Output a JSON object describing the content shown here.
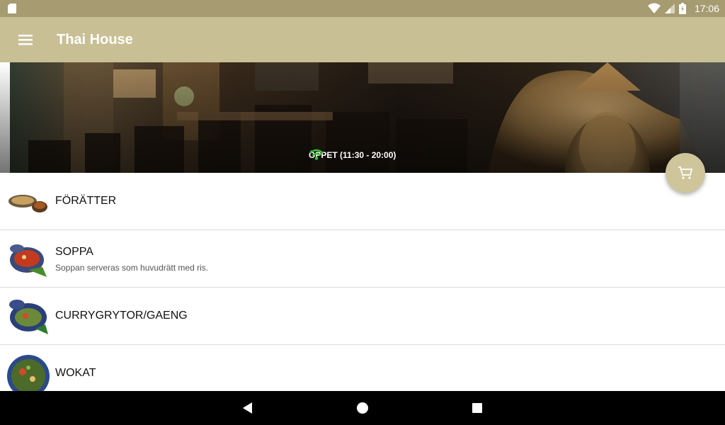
{
  "status_bar": {
    "time": "17:06",
    "icons": [
      "sd-card-icon",
      "wifi-icon",
      "signal-icon",
      "battery-icon"
    ]
  },
  "app_bar": {
    "title": "Thai House",
    "menu_icon": "hamburger-menu-icon",
    "background": "#c9bf95"
  },
  "hero": {
    "open_status": "ÖPPET (11:30 - 20:00)",
    "status_icon": "wifi-icon",
    "status_color": "#3dbf3d"
  },
  "cart": {
    "icon": "shopping-cart-icon"
  },
  "categories": [
    {
      "name": "FÖRÄTTER",
      "description": ""
    },
    {
      "name": "SOPPA",
      "description": "Soppan serveras som huvudrätt med ris."
    },
    {
      "name": "CURRYGRYTOR/GAENG",
      "description": ""
    },
    {
      "name": "WOKAT",
      "description": ""
    }
  ],
  "nav_bar": {
    "buttons": [
      "back-icon",
      "home-icon",
      "recents-icon"
    ]
  }
}
